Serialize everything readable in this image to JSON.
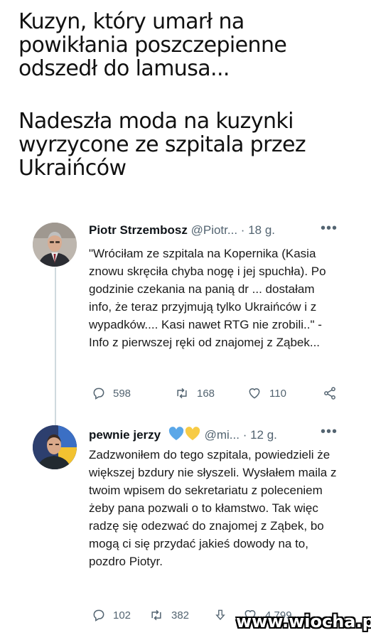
{
  "caption": {
    "line1": "Kuzyn, który umarł na powikłania poszczepienne odszedł do lamusa...",
    "line2": "Nadeszła moda na kuzynki wyrzycone ze szpitala przez Ukraińców"
  },
  "tweets": [
    {
      "name": "Piotr Strzembosz",
      "handle": "@Piotr...",
      "separator": "·",
      "age": "18 g.",
      "more": "•••",
      "text": "\"Wróciłam ze szpitala na Kopernika (Kasia znowu skręciła chyba nogę i jej spuchła). Po godzinie czekania na panią dr ... dostałam info, że teraz przyjmują tylko Ukraińców i z wypadków.... Kasi nawet RTG nie zrobili..\" - Info z pierwszej ręki od znajomej z Ząbek...",
      "replies": "598",
      "retweets": "168",
      "likes": "110",
      "icons": [
        "reply-icon",
        "retweet-icon",
        "like-icon",
        "share-icon"
      ]
    },
    {
      "name": "pewnie jerzy",
      "handle": "@mi...",
      "separator": "·",
      "age": "12 g.",
      "more": "•••",
      "name_emoji": [
        "blue-heart",
        "yellow-heart"
      ],
      "text": "Zadzwoniłem do tego szpitala, powiedzieli że większej bzdury nie słyszeli. Wysłałem maila z twoim wpisem do sekretariatu z poleceniem żeby pana pozwali o to kłamstwo. Tak więc radzę się odezwać do znajomej z Ząbek, bo mogą ci się przydać jakieś dowody na to, pozdro Piotyr.",
      "replies": "102",
      "retweets": "382",
      "likes": "4 799",
      "icons": [
        "reply-icon",
        "retweet-icon",
        "downvote-icon",
        "like-icon"
      ]
    }
  ],
  "watermark": "www.wiocha.pl",
  "colors": {
    "secondary_text": "#536471",
    "thread_line": "#cfd9de",
    "heart_blue": "#5aa7e8",
    "heart_yellow": "#f7cb45"
  }
}
